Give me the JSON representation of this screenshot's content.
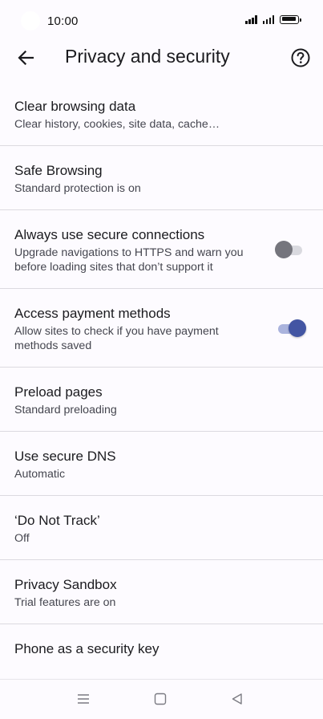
{
  "status_bar": {
    "time": "10:00"
  },
  "app_bar": {
    "title": "Privacy and security",
    "back_icon": "arrow-back-icon",
    "help_icon": "help-circle-icon"
  },
  "settings": [
    {
      "title": "Clear browsing data",
      "subtitle": "Clear history, cookies, site data, cache…"
    },
    {
      "title": "Safe Browsing",
      "subtitle": "Standard protection is on"
    },
    {
      "title": "Always use secure connections",
      "subtitle": "Upgrade navigations to HTTPS and warn you before loading sites that don’t support it",
      "toggle": "off"
    },
    {
      "title": "Access payment methods",
      "subtitle": "Allow sites to check if you have payment methods saved",
      "toggle": "on"
    },
    {
      "title": "Preload pages",
      "subtitle": "Standard preloading"
    },
    {
      "title": "Use secure DNS",
      "subtitle": "Automatic"
    },
    {
      "title": "‘Do Not Track’",
      "subtitle": "Off"
    },
    {
      "title": "Privacy Sandbox",
      "subtitle": "Trial features are on"
    },
    {
      "title": "Phone as a security key"
    }
  ],
  "colors": {
    "background": "#fdfbff",
    "toggle_on": "#4355a3",
    "toggle_off": "#75757d",
    "divider": "#dcdae0"
  },
  "nav_bar": {
    "icons": [
      "menu-icon",
      "home-square-icon",
      "back-triangle-icon"
    ]
  }
}
